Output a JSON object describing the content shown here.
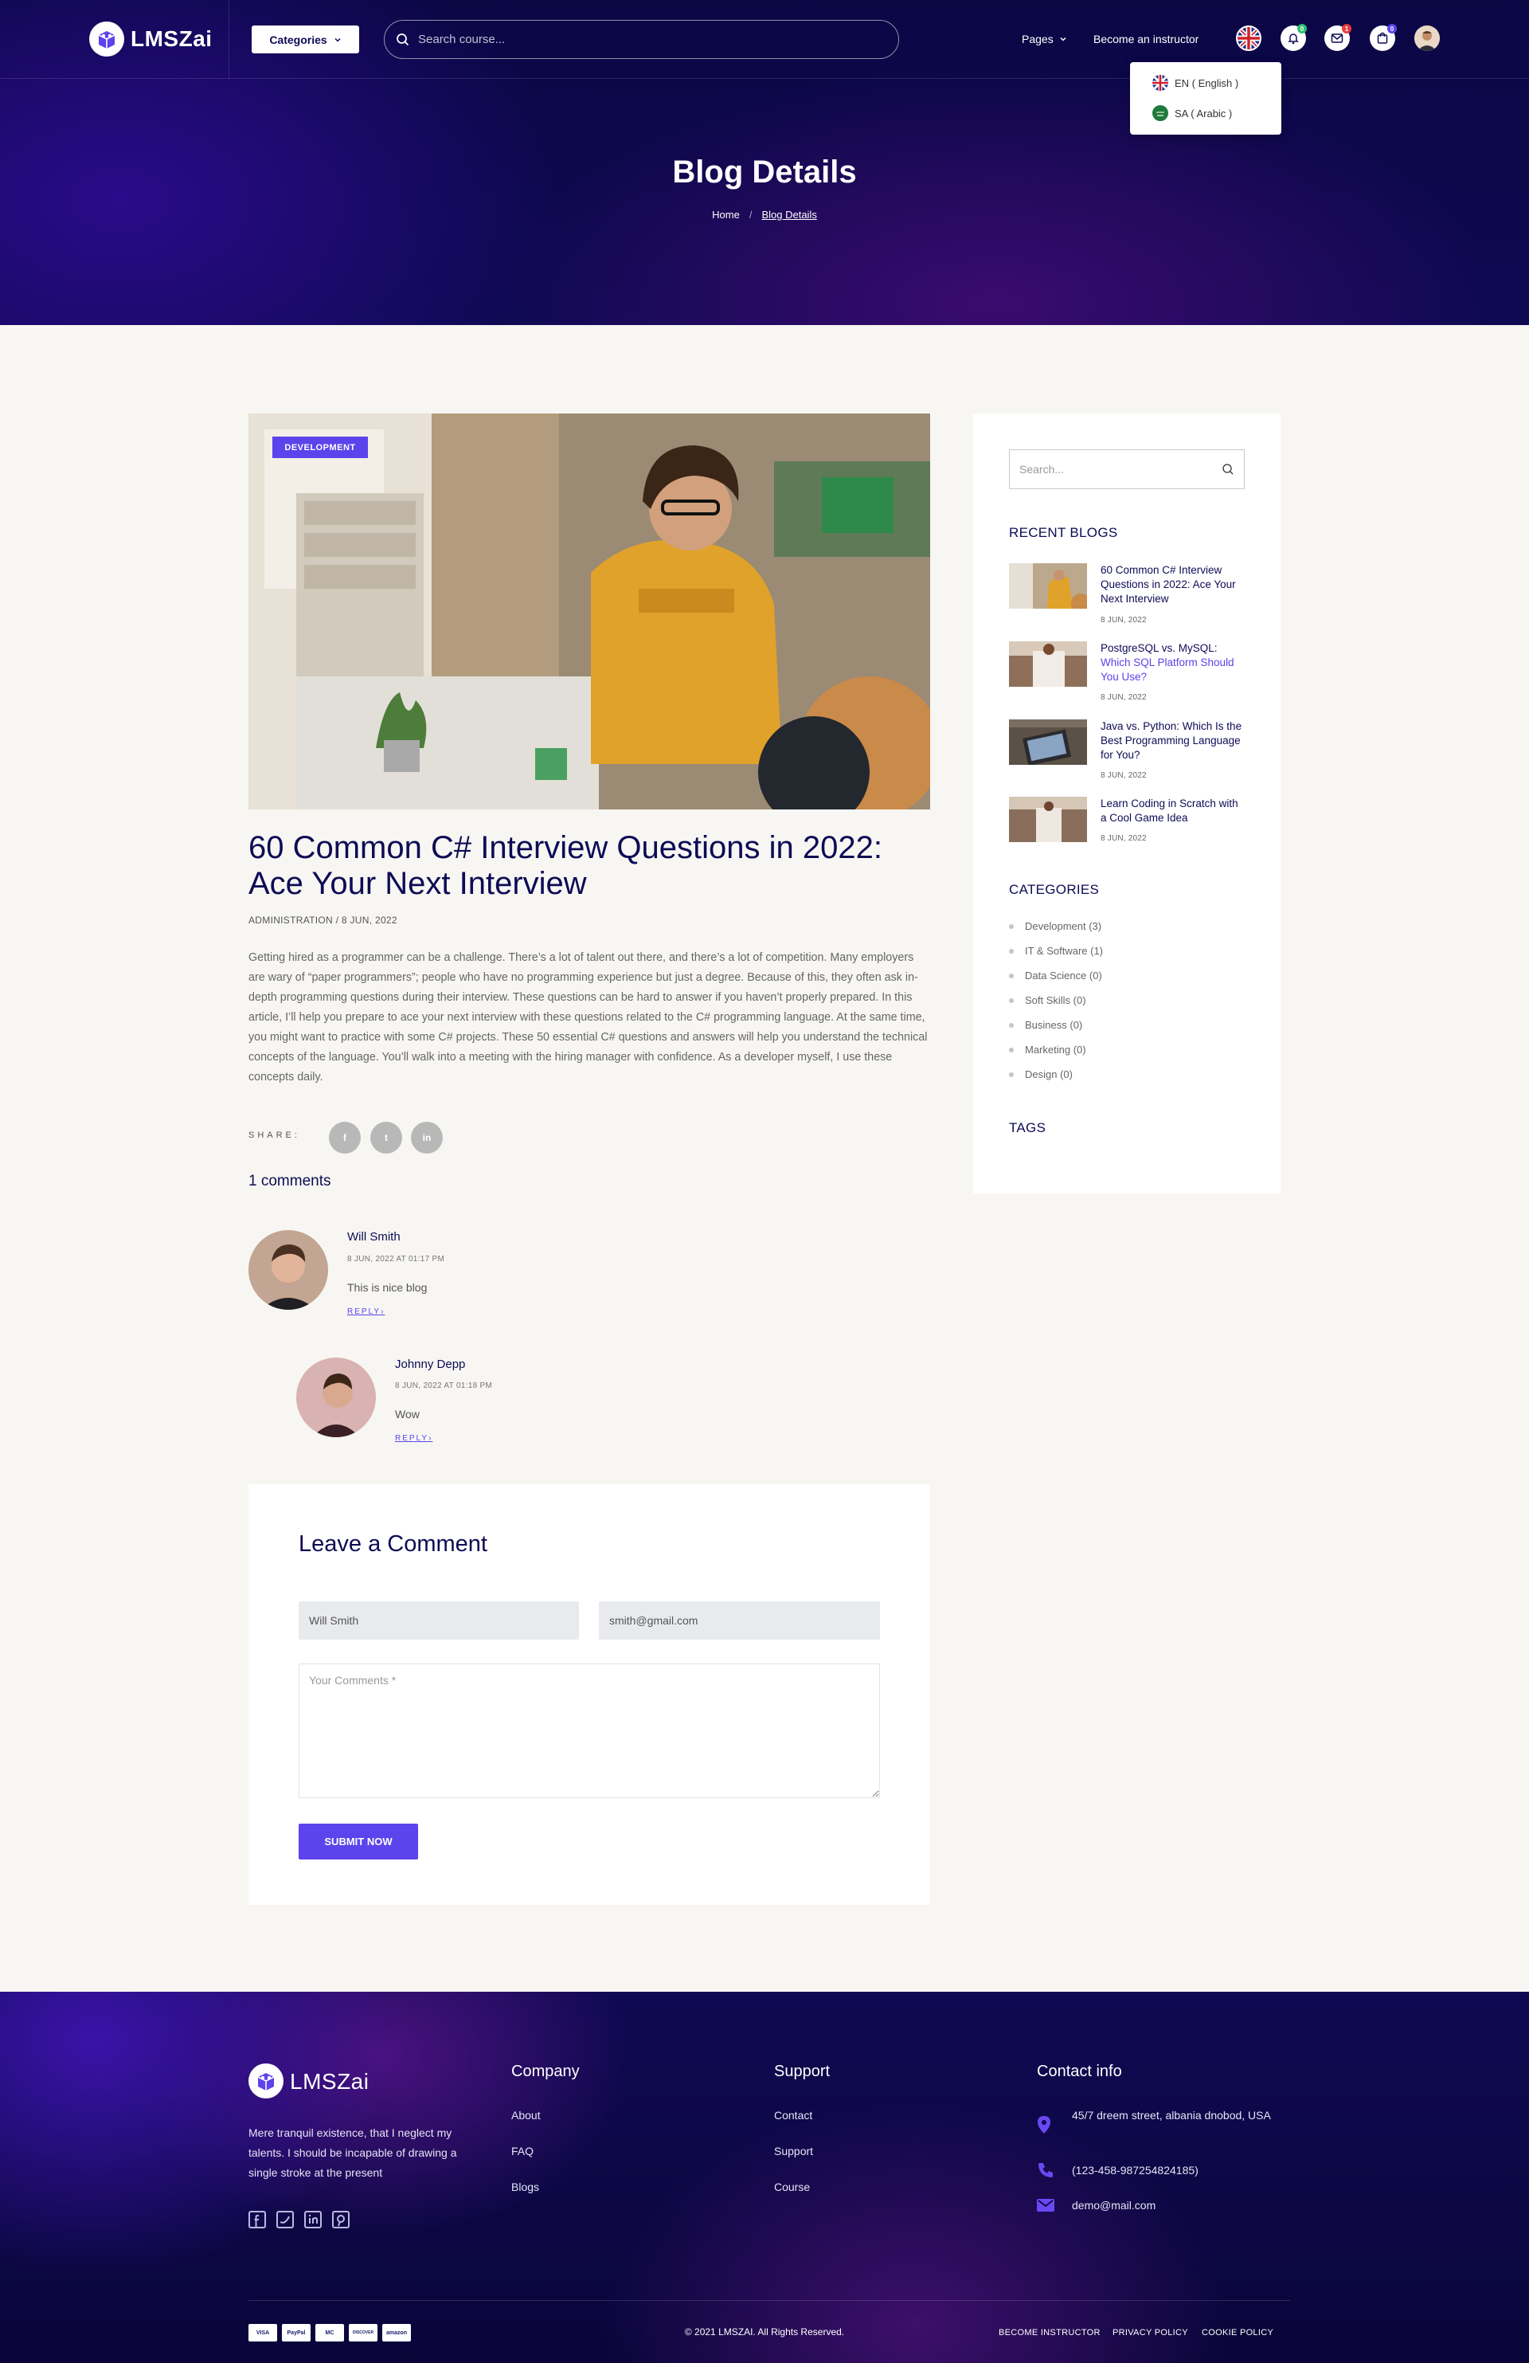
{
  "header": {
    "brand": "LMSZai",
    "categories_label": "Categories",
    "search_placeholder": "Search course...",
    "pages_label": "Pages",
    "become_instructor": "Become an instructor",
    "notification_badges": {
      "bell": "0",
      "mail": "1",
      "cart": "0"
    },
    "language_menu": [
      {
        "label": "EN ( English )"
      },
      {
        "label": "SA ( Arabic )"
      }
    ]
  },
  "hero": {
    "title": "Blog Details",
    "breadcrumb": {
      "home": "Home",
      "separator": "/",
      "current": "Blog Details"
    }
  },
  "post": {
    "tag": "DEVELOPMENT",
    "title": "60 Common C# Interview Questions in 2022: Ace Your Next Interview",
    "meta": "ADMINISTRATION / 8 JUN, 2022",
    "body": "Getting hired as a programmer can be a challenge. There’s a lot of talent out there, and there’s a lot of competition. Many employers are wary of “paper programmers”; people who have no programming experience but just a degree. Because of this, they often ask in-depth programming questions during their interview. These questions can be hard to answer if you haven’t properly prepared. In this article, I’ll help you prepare to ace your next interview with these questions related to the C# programming language. At the same time, you might want to practice with some C# projects. These 50 essential C# questions and answers will help you understand the technical concepts of the language. You’ll walk into a meeting with the hiring manager with confidence. As a developer myself, I use these concepts daily.",
    "share_label": "SHARE:",
    "share_icons": [
      "f",
      "t",
      "in"
    ]
  },
  "comments": {
    "count_label": "1 comments",
    "items": [
      {
        "name": "Will Smith",
        "date": "8 JUN, 2022 AT 01:17 PM",
        "text": "This is nice blog",
        "reply": "REPLY"
      },
      {
        "name": "Johnny Depp",
        "date": "8 JUN, 2022 AT 01:18 PM",
        "text": "Wow",
        "reply": "REPLY"
      }
    ]
  },
  "comment_form": {
    "title": "Leave a Comment",
    "name_value": "Will Smith",
    "email_value": "smith@gmail.com",
    "comments_placeholder": "Your Comments *",
    "submit_label": "SUBMIT NOW"
  },
  "sidebar": {
    "search_placeholder": "Search...",
    "recent_heading": "RECENT BLOGS",
    "recent": [
      {
        "title": "60 Common C# Interview Questions in 2022: Ace Your Next Interview",
        "date": "8 JUN, 2022"
      },
      {
        "title_a": "PostgreSQL vs. MySQL:",
        "title_b": "Which SQL Platform Should You Use?",
        "date": "8 JUN, 2022"
      },
      {
        "title": "Java vs. Python: Which Is the Best Programming Language for You?",
        "date": "8 JUN, 2022"
      },
      {
        "title": "Learn Coding in Scratch with a Cool Game Idea",
        "date": "8 JUN, 2022"
      }
    ],
    "categories_heading": "CATEGORIES",
    "categories": [
      "Development (3)",
      "IT & Software (1)",
      "Data Science (0)",
      "Soft Skills (0)",
      "Business (0)",
      "Marketing (0)",
      "Design (0)"
    ],
    "tags_heading": "TAGS"
  },
  "footer": {
    "brand": "LMSZai",
    "about": "Mere tranquil existence, that I neglect my talents. I should be incapable of drawing a single stroke at the present",
    "company_heading": "Company",
    "company_links": [
      "About",
      "FAQ",
      "Blogs"
    ],
    "support_heading": "Support",
    "support_links": [
      "Contact",
      "Support",
      "Course"
    ],
    "contact_heading": "Contact info",
    "address": "45/7 dreem street, albania dnobod, USA",
    "phone": "(123-458-987254824185)",
    "email": "demo@mail.com",
    "payments": [
      "VISA",
      "PayPal",
      "MC",
      "DISCOVER",
      "amazon"
    ],
    "copyright": "© 2021 LMSZAI. All Rights Reserved.",
    "bottom_links": [
      "BECOME INSTRUCTOR",
      "PRIVACY POLICY",
      "COOKIE POLICY"
    ]
  },
  "colors": {
    "accent": "#5c43ec",
    "navy": "#0e0b55",
    "dark_bg": "#0b0745"
  }
}
